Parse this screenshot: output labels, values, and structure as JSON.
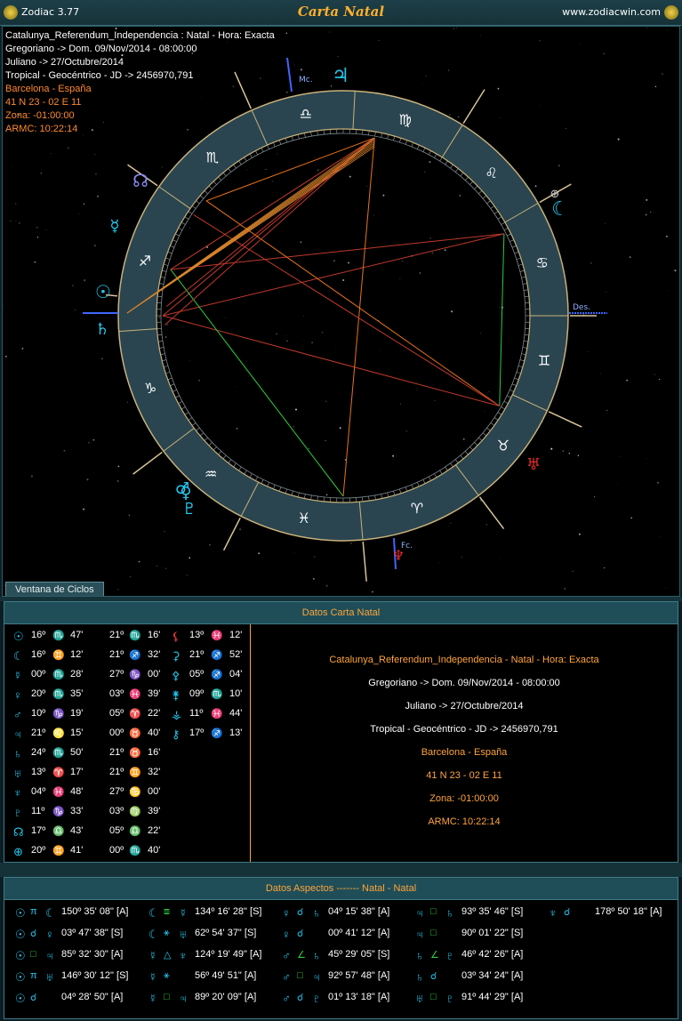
{
  "window": {
    "app_label": "Zodiac 3.77",
    "title": "Carta Natal",
    "site": "www.zodiacwin.com"
  },
  "chart_info": [
    {
      "text": "Catalunya_Referendum_Independencia : Natal - Hora: Exacta",
      "color": "#ffffff"
    },
    {
      "text": "Gregoriano -> Dom. 09/Nov/2014 - 08:00:00",
      "color": "#ffffff"
    },
    {
      "text": "Juliano -> 27/Octubre/2014",
      "color": "#ffffff"
    },
    {
      "text": "Tropical - Geocéntrico - JD -> 2456970,791",
      "color": "#ffffff"
    },
    {
      "text": "Barcelona - España",
      "color": "#ff8a2a"
    },
    {
      "text": "41 N 23 - 02 E 11",
      "color": "#ff8a2a"
    },
    {
      "text": "Zona: -01:00:00",
      "color": "#ff8a2a"
    },
    {
      "text": "ARMC: 10:22:14",
      "color": "#ff8a2a"
    }
  ],
  "wheel": {
    "signs": [
      "♈",
      "♉",
      "♊",
      "♋",
      "♌",
      "♍",
      "♎",
      "♏",
      "♐",
      "♑",
      "♒",
      "♓"
    ],
    "mc_label": "Mc.",
    "desc_label": "Des.",
    "fc_label": "Fc.",
    "planets": [
      {
        "name": "sun-icon",
        "glyph": "☉",
        "color": "#22c8ee"
      },
      {
        "name": "moon-icon",
        "glyph": "☾",
        "color": "#22c8ee"
      },
      {
        "name": "mercury-icon",
        "glyph": "☿",
        "color": "#22c8ee"
      },
      {
        "name": "venus-icon",
        "glyph": "♀",
        "color": "#22c8ee"
      },
      {
        "name": "mars-icon",
        "glyph": "♂",
        "color": "#22c8ee"
      },
      {
        "name": "jupiter-icon",
        "glyph": "♃",
        "color": "#22c8ee"
      },
      {
        "name": "saturn-icon",
        "glyph": "♄",
        "color": "#22c8ee"
      },
      {
        "name": "uranus-icon",
        "glyph": "♅",
        "color": "#e82a2a"
      },
      {
        "name": "neptune-icon",
        "glyph": "♆",
        "color": "#e82a2a"
      },
      {
        "name": "pluto-icon",
        "glyph": "♇",
        "color": "#22c8ee"
      },
      {
        "name": "node-icon",
        "glyph": "☊",
        "color": "#8a8cf2"
      },
      {
        "name": "fortune-icon",
        "glyph": "⊕",
        "color": "#c8c8c8"
      }
    ]
  },
  "ciclos_button": "Ventana de Ciclos",
  "natal_panel": {
    "header": "Datos Carta Natal",
    "positions": [
      {
        "glyph": "☉",
        "deg": "16º",
        "sign": "♏",
        "min": "47'"
      },
      {
        "glyph": "☾",
        "deg": "16º",
        "sign": "♊",
        "min": "12'"
      },
      {
        "glyph": "☿",
        "deg": "00º",
        "sign": "♏",
        "min": "28'"
      },
      {
        "glyph": "♀",
        "deg": "20º",
        "sign": "♏",
        "min": "35'"
      },
      {
        "glyph": "♂",
        "deg": "10º",
        "sign": "♑",
        "min": "19'"
      },
      {
        "glyph": "♃",
        "deg": "21º",
        "sign": "♌",
        "min": "15'"
      },
      {
        "glyph": "♄",
        "deg": "24º",
        "sign": "♏",
        "min": "50'"
      },
      {
        "glyph": "♅",
        "deg": "13º",
        "sign": "♈",
        "min": "17'"
      },
      {
        "glyph": "♆",
        "deg": "04º",
        "sign": "♓",
        "min": "48'"
      },
      {
        "glyph": "♇",
        "deg": "11º",
        "sign": "♑",
        "min": "33'"
      },
      {
        "glyph": "☊",
        "deg": "17º",
        "sign": "♎",
        "min": "43'"
      },
      {
        "glyph": "⊕",
        "deg": "20º",
        "sign": "♊",
        "min": "41'"
      }
    ],
    "houses": [
      {
        "deg": "21º",
        "sign": "♏",
        "min": "16'"
      },
      {
        "deg": "21º",
        "sign": "♐",
        "min": "32'"
      },
      {
        "deg": "27º",
        "sign": "♑",
        "min": "00'"
      },
      {
        "deg": "03º",
        "sign": "♓",
        "min": "39'"
      },
      {
        "deg": "05º",
        "sign": "♈",
        "min": "22'"
      },
      {
        "deg": "00º",
        "sign": "♉",
        "min": "40'"
      },
      {
        "deg": "21º",
        "sign": "♉",
        "min": "16'"
      },
      {
        "deg": "21º",
        "sign": "♊",
        "min": "32'"
      },
      {
        "deg": "27º",
        "sign": "♋",
        "min": "00'"
      },
      {
        "deg": "03º",
        "sign": "♍",
        "min": "39'"
      },
      {
        "deg": "05º",
        "sign": "♎",
        "min": "22'"
      },
      {
        "deg": "00º",
        "sign": "♏",
        "min": "40'"
      }
    ],
    "asteroids": [
      {
        "glyph": "⚸",
        "gcolor": "#ee3a3a",
        "deg": "13º",
        "sign": "♓",
        "min": "12'"
      },
      {
        "glyph": "⚳",
        "gcolor": "#22c8ee",
        "deg": "21º",
        "sign": "♐",
        "min": "52'"
      },
      {
        "glyph": "⚴",
        "gcolor": "#22c8ee",
        "deg": "05º",
        "sign": "♐",
        "min": "04'"
      },
      {
        "glyph": "⚵",
        "gcolor": "#22c8ee",
        "deg": "09º",
        "sign": "♏",
        "min": "10'"
      },
      {
        "glyph": "⚶",
        "gcolor": "#22c8ee",
        "deg": "11º",
        "sign": "♓",
        "min": "44'"
      },
      {
        "glyph": "⚷",
        "gcolor": "#22c8ee",
        "deg": "17º",
        "sign": "♐",
        "min": "13'"
      }
    ],
    "datos": [
      {
        "text": "Catalunya_Referendum_Independencia - Natal - Hora: Exacta",
        "color": "#ffa43a"
      },
      {
        "text": "Gregoriano -> Dom. 09/Nov/2014 - 08:00:00",
        "color": "#ffffff"
      },
      {
        "text": "Juliano -> 27/Octubre/2014",
        "color": "#ffffff"
      },
      {
        "text": "Tropical - Geocéntrico - JD -> 2456970,791",
        "color": "#ffffff"
      },
      {
        "text": "Barcelona - España",
        "color": "#ffa43a"
      },
      {
        "text": "41 N 23 - 02 E 11",
        "color": "#ffa43a"
      },
      {
        "text": "Zona: -01:00:00",
        "color": "#ffa43a"
      },
      {
        "text": "ARMC: 10:22:14",
        "color": "#ffa43a"
      }
    ]
  },
  "aspects_panel": {
    "header": "Datos Aspectos   -------   Natal - Natal",
    "columns": [
      [
        {
          "p1": "☉",
          "asp": "π",
          "p2": "☾",
          "val": "150º 35' 08\" [A]"
        },
        {
          "p1": "☉",
          "asp": "☌",
          "p2": "♀",
          "val": "03º 47' 38\" [S]"
        },
        {
          "p1": "☉",
          "asp": "□",
          "p2": "♃",
          "val": "85º 32' 30\" [A]"
        },
        {
          "p1": "☉",
          "asp": "π",
          "p2": "♅",
          "val": "146º 30' 12\" [S]"
        },
        {
          "p1": "☉",
          "asp": "☌",
          "p2": "",
          "val": "04º 28' 50\" [A]"
        }
      ],
      [
        {
          "p1": "☾",
          "asp": "⧈",
          "p2": "☿",
          "val": "134º 16' 28\" [S]"
        },
        {
          "p1": "☾",
          "asp": "⚹",
          "p2": "♅",
          "val": "62º 54' 37\" [S]"
        },
        {
          "p1": "☿",
          "asp": "△",
          "p2": "♆",
          "val": "124º 19' 49\" [A]"
        },
        {
          "p1": "☿",
          "asp": "⚹",
          "p2": "",
          "val": "56º 49' 51\" [A]"
        },
        {
          "p1": "☿",
          "asp": "□",
          "p2": "♃",
          "val": "89º 20' 09\" [A]"
        }
      ],
      [
        {
          "p1": "♀",
          "asp": "☌",
          "p2": "♄",
          "val": "04º 15' 38\" [A]"
        },
        {
          "p1": "♀",
          "asp": "☌",
          "p2": "",
          "val": "00º 41' 12\" [A]"
        },
        {
          "p1": "♂",
          "asp": "∠",
          "p2": "♄",
          "val": "45º 29' 05\" [S]"
        },
        {
          "p1": "♂",
          "asp": "□",
          "p2": "♃",
          "val": "92º 57' 48\" [A]"
        },
        {
          "p1": "♂",
          "asp": "☌",
          "p2": "♇",
          "val": "01º 13' 18\" [A]"
        }
      ],
      [
        {
          "p1": "♃",
          "asp": "□",
          "p2": "♄",
          "val": "93º 35' 46\" [S]"
        },
        {
          "p1": "♃",
          "asp": "□",
          "p2": "",
          "val": "90º 01' 22\" [S]"
        },
        {
          "p1": "♄",
          "asp": "∠",
          "p2": "♇",
          "val": "46º 42' 26\" [A]"
        },
        {
          "p1": "♄",
          "asp": "☌",
          "p2": "",
          "val": "03º 34' 24\" [A]"
        },
        {
          "p1": "♅",
          "asp": "□",
          "p2": "♇",
          "val": "91º 44' 29\" [A]"
        }
      ],
      [
        {
          "p1": "♆",
          "asp": "☌",
          "p2": "",
          "val": "178º 50' 18\" [A]"
        }
      ]
    ]
  }
}
